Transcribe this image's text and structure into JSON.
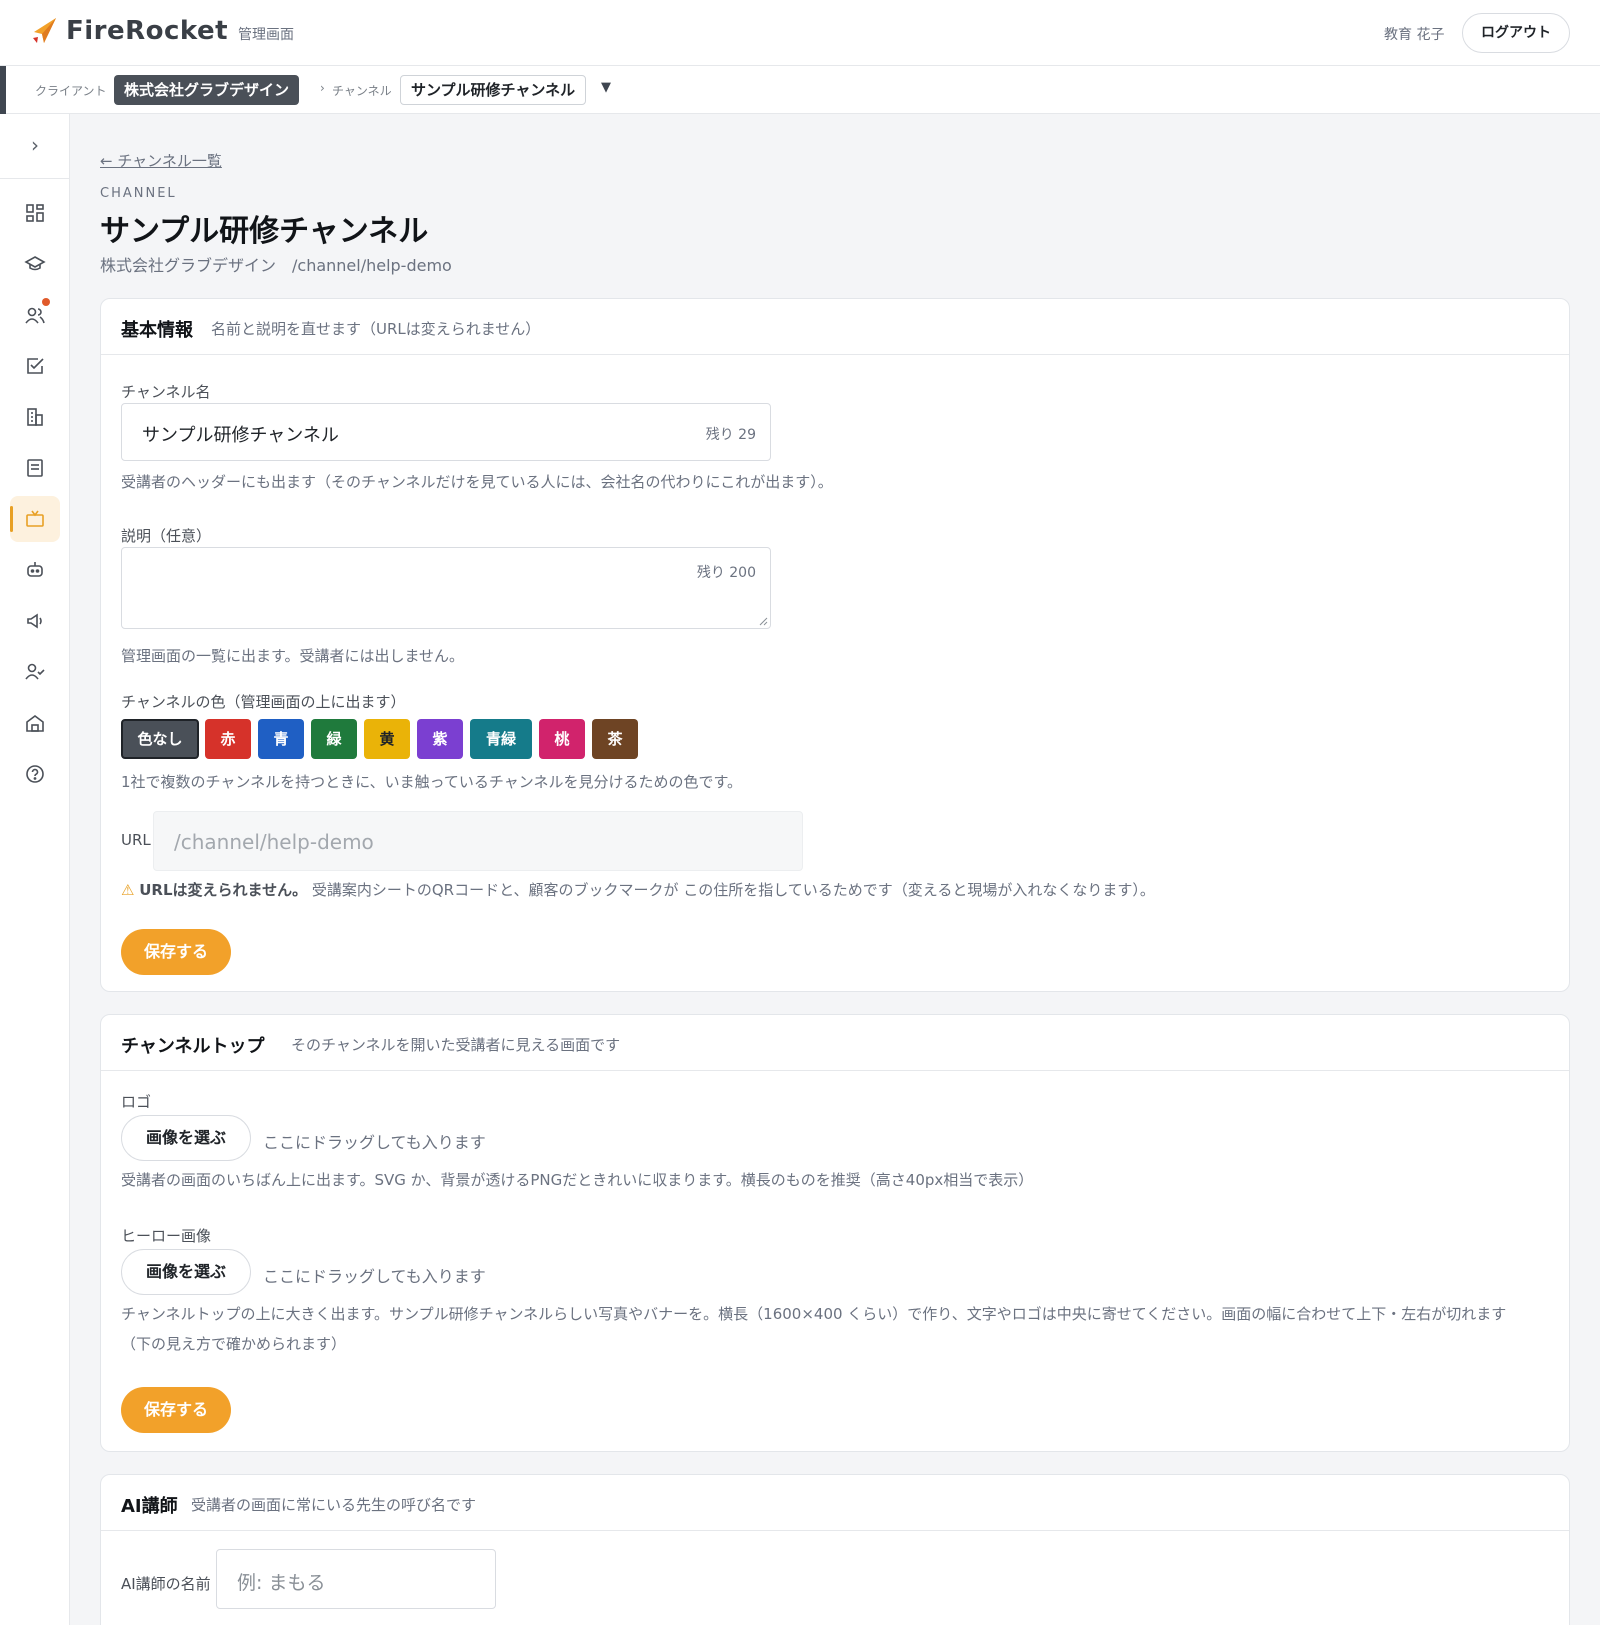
{
  "header": {
    "brand": "FireRocket",
    "brand_sub": "管理画面",
    "user_name": "教育 花子",
    "logout": "ログアウト"
  },
  "breadcrumb": {
    "client_label": "クライアント",
    "client_value": "株式会社グラブデザイン",
    "separator": "›",
    "channel_label": "チャンネル",
    "channel_value": "サンプル研修チャンネル",
    "caret": "▼"
  },
  "sidebar": {
    "toggle": "›",
    "items": [
      {
        "icon": "dashboard-icon"
      },
      {
        "icon": "graduation-cap-icon"
      },
      {
        "icon": "users-icon",
        "notification": true
      },
      {
        "icon": "checklist-icon"
      },
      {
        "icon": "building-icon"
      },
      {
        "icon": "document-icon"
      },
      {
        "icon": "tv-channel-icon",
        "active": true
      },
      {
        "icon": "robot-icon"
      },
      {
        "icon": "megaphone-icon"
      },
      {
        "icon": "user-check-icon"
      },
      {
        "icon": "home-icon"
      },
      {
        "icon": "help-icon"
      }
    ],
    "accent_color": "#e8a024"
  },
  "page": {
    "back_link": "← チャンネル一覧",
    "eyebrow": "CHANNEL",
    "title": "サンプル研修チャンネル",
    "subtitle": "株式会社グラブデザイン　/channel/help-demo"
  },
  "basic": {
    "title": "基本情報",
    "desc": "名前と説明を直せます（URLは変えられません）",
    "name_label": "チャンネル名",
    "name_value": "サンプル研修チャンネル",
    "name_counter": "残り 29",
    "name_hint": "受講者のヘッダーにも出ます（そのチャンネルだけを見ている人には、会社名の代わりにこれが出ます）。",
    "desc_label": "説明（任意）",
    "desc_value": "",
    "desc_counter": "残り 200",
    "desc_hint": "管理画面の一覧に出ます。受講者には出しません。",
    "color_label": "チャンネルの色（管理画面の上に出ます）",
    "colors": [
      {
        "label": "色なし",
        "hex": "#4a5058",
        "selected": true
      },
      {
        "label": "赤",
        "hex": "#d6322a"
      },
      {
        "label": "青",
        "hex": "#1f5fc4"
      },
      {
        "label": "緑",
        "hex": "#1f7a3c"
      },
      {
        "label": "黄",
        "hex": "#eab308",
        "text": "#1f2328"
      },
      {
        "label": "紫",
        "hex": "#7b3fd1"
      },
      {
        "label": "青緑",
        "hex": "#157b8a"
      },
      {
        "label": "桃",
        "hex": "#d1236c"
      },
      {
        "label": "茶",
        "hex": "#6e4424"
      }
    ],
    "color_hint": "1社で複数のチャンネルを持つときに、いま触っているチャンネルを見分けるための色です。",
    "url_label": "URL",
    "url_value": "/channel/help-demo",
    "warn_icon": "⚠",
    "warn_bold": "URLは変えられません。",
    "warn_text": "受講案内シートのQRコードと、顧客のブックマークが この住所を指しているためです（変えると現場が入れなくなります）。",
    "save": "保存する"
  },
  "top": {
    "title": "チャンネルトップ",
    "desc": "そのチャンネルを開いた受講者に見える画面です",
    "logo_label": "ロゴ",
    "pick": "画像を選ぶ",
    "drop": "ここにドラッグしても入ります",
    "logo_hint": "受講者の画面のいちばん上に出ます。SVG か、背景が透けるPNGだときれいに収まります。横長のものを推奨（高さ40px相当で表示）",
    "hero_label": "ヒーロー画像",
    "hero_hint": "チャンネルトップの上に大きく出ます。サンプル研修チャンネルらしい写真やバナーを。横長（1600×400 くらい）で作り、文字やロゴは中央に寄せてください。画面の幅に合わせて上下・左右が切れます（下の見え方で確かめられます）",
    "save": "保存する"
  },
  "ai": {
    "title": "AI講師",
    "desc": "受講者の画面に常にいる先生の呼び名です",
    "name_label": "AI講師の名前",
    "name_placeholder": "例: まもる"
  },
  "colors": {
    "accent": "#f2a12a",
    "brand_dark": "#3a3f46"
  }
}
